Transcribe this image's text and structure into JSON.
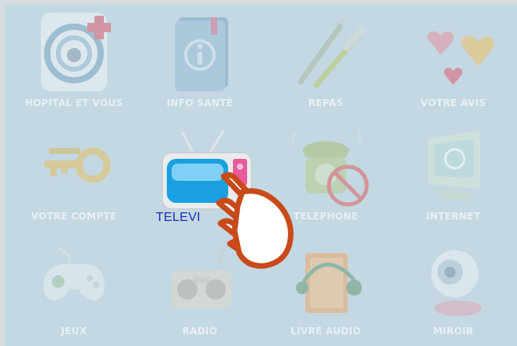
{
  "menu": {
    "items": [
      {
        "label": "HOPITAL ET VOUS",
        "icon": "hospital-care-icon"
      },
      {
        "label": "INFO SANTE",
        "icon": "info-book-icon"
      },
      {
        "label": "REPAS",
        "icon": "fork-knife-icon"
      },
      {
        "label": "VOTRE AVIS",
        "icon": "hearts-icon"
      },
      {
        "label": "VOTRE COMPTE",
        "icon": "keys-icon"
      },
      {
        "label": "TELEVI",
        "icon": "television-icon",
        "selected": true
      },
      {
        "label": "TELEPHONE",
        "icon": "telephone-blocked-icon"
      },
      {
        "label": "INTERNET",
        "icon": "internet-monitor-icon"
      },
      {
        "label": "JEUX",
        "icon": "gamepad-icon"
      },
      {
        "label": "RADIO",
        "icon": "radio-icon"
      },
      {
        "label": "LIVRE AUDIO",
        "icon": "audio-book-icon"
      },
      {
        "label": "MIROIR",
        "icon": "webcam-icon"
      }
    ]
  },
  "colors": {
    "background": "#c3d8e2",
    "selected_label": "#1a2ab8",
    "hand": "#c84a1a"
  }
}
